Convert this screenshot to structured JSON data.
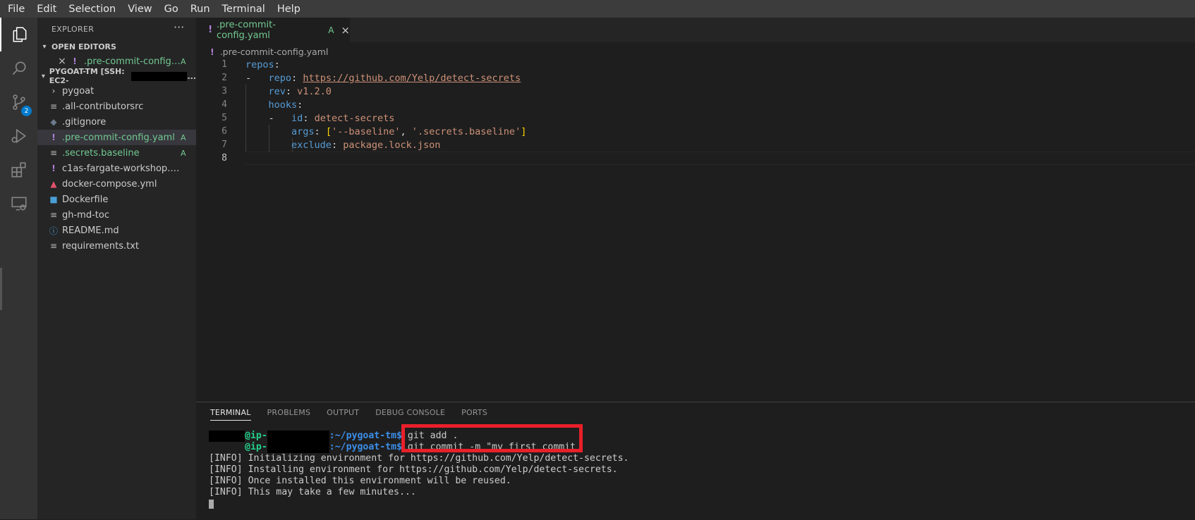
{
  "menu": [
    "File",
    "Edit",
    "Selection",
    "View",
    "Go",
    "Run",
    "Terminal",
    "Help"
  ],
  "activity": {
    "scm_badge": "2"
  },
  "explorer": {
    "title": "EXPLORER",
    "more": "···",
    "open_editors_label": "OPEN EDITORS",
    "open_editor": {
      "close": "×",
      "prefix": "!",
      "name": ".pre-commit-config....",
      "status": "A"
    },
    "workspace_label": "PYGOAT-TM [SSH: EC2-",
    "workspace_suffix": "...",
    "files": [
      {
        "icon": "chevron-right-icon",
        "glyph": "›",
        "name": "pygoat",
        "status": "",
        "color": "#cccccc"
      },
      {
        "icon": "file-lines-icon",
        "glyph": "≡",
        "name": ".all-contributorsrc",
        "status": "",
        "color": "#cccccc"
      },
      {
        "icon": "git-diamond-icon",
        "glyph": "◆",
        "name": ".gitignore",
        "status": "",
        "color": "#cccccc"
      },
      {
        "icon": "yaml-exclaim-icon",
        "glyph": "!",
        "name": ".pre-commit-config.yaml",
        "status": "A",
        "color": "#73c991"
      },
      {
        "icon": "file-lines-icon",
        "glyph": "≡",
        "name": ".secrets.baseline",
        "status": "A",
        "color": "#73c991"
      },
      {
        "icon": "yaml-exclaim-icon",
        "glyph": "!",
        "name": "c1as-fargate-workshop.yaml",
        "status": "",
        "color": "#cccccc"
      },
      {
        "icon": "docker-compose-icon",
        "glyph": "▲",
        "name": "docker-compose.yml",
        "status": "",
        "color": "#cccccc"
      },
      {
        "icon": "docker-icon",
        "glyph": "■",
        "name": "Dockerfile",
        "status": "",
        "color": "#cccccc"
      },
      {
        "icon": "file-lines-icon",
        "glyph": "≡",
        "name": "gh-md-toc",
        "status": "",
        "color": "#cccccc"
      },
      {
        "icon": "info-icon",
        "glyph": "ⓘ",
        "name": "README.md",
        "status": "",
        "color": "#cccccc"
      },
      {
        "icon": "file-lines-icon",
        "glyph": "≡",
        "name": "requirements.txt",
        "status": "",
        "color": "#cccccc"
      }
    ]
  },
  "editor": {
    "tab": {
      "prefix": "!",
      "name": ".pre-commit-config.yaml",
      "status": "A",
      "close": "×"
    },
    "breadcrumb": {
      "prefix": "!",
      "name": ".pre-commit-config.yaml"
    },
    "line_numbers": [
      "1",
      "2",
      "3",
      "4",
      "5",
      "6",
      "7",
      "8"
    ],
    "code": {
      "l1": {
        "key": "repos",
        "colon": ":"
      },
      "l2": {
        "dash": "-",
        "key": "repo",
        "colon": ": ",
        "value": "https://github.com/Yelp/detect-secrets"
      },
      "l3": {
        "key": "rev",
        "colon": ": ",
        "value": "v1.2.0"
      },
      "l4": {
        "key": "hooks",
        "colon": ":"
      },
      "l5": {
        "dash": "-",
        "key": "id",
        "colon": ": ",
        "value": "detect-secrets"
      },
      "l6": {
        "key": "args",
        "colon": ": ",
        "open": "[",
        "v1": "'--baseline'",
        "comma": ", ",
        "v2": "'.secrets.baseline'",
        "close": "]"
      },
      "l7": {
        "key": "exclude",
        "colon": ": ",
        "value": "package.lock.json"
      }
    }
  },
  "panel": {
    "tabs": [
      "TERMINAL",
      "PROBLEMS",
      "OUTPUT",
      "DEBUG CONSOLE",
      "PORTS"
    ],
    "terminal": {
      "host_prefix": "@ip-",
      "path": ":~/pygoat-tm$",
      "cmd1": " git add .",
      "cmd2": " git commit -m \"my first commit",
      "output": [
        "[INFO] Initializing environment for https://github.com/Yelp/detect-secrets.",
        "[INFO] Installing environment for https://github.com/Yelp/detect-secrets.",
        "[INFO] Once installed this environment will be reused.",
        "[INFO] This may take a few minutes..."
      ]
    }
  },
  "colors": {
    "highlight": "#e8202a",
    "accent": "#007acc",
    "git_added": "#73c991"
  }
}
